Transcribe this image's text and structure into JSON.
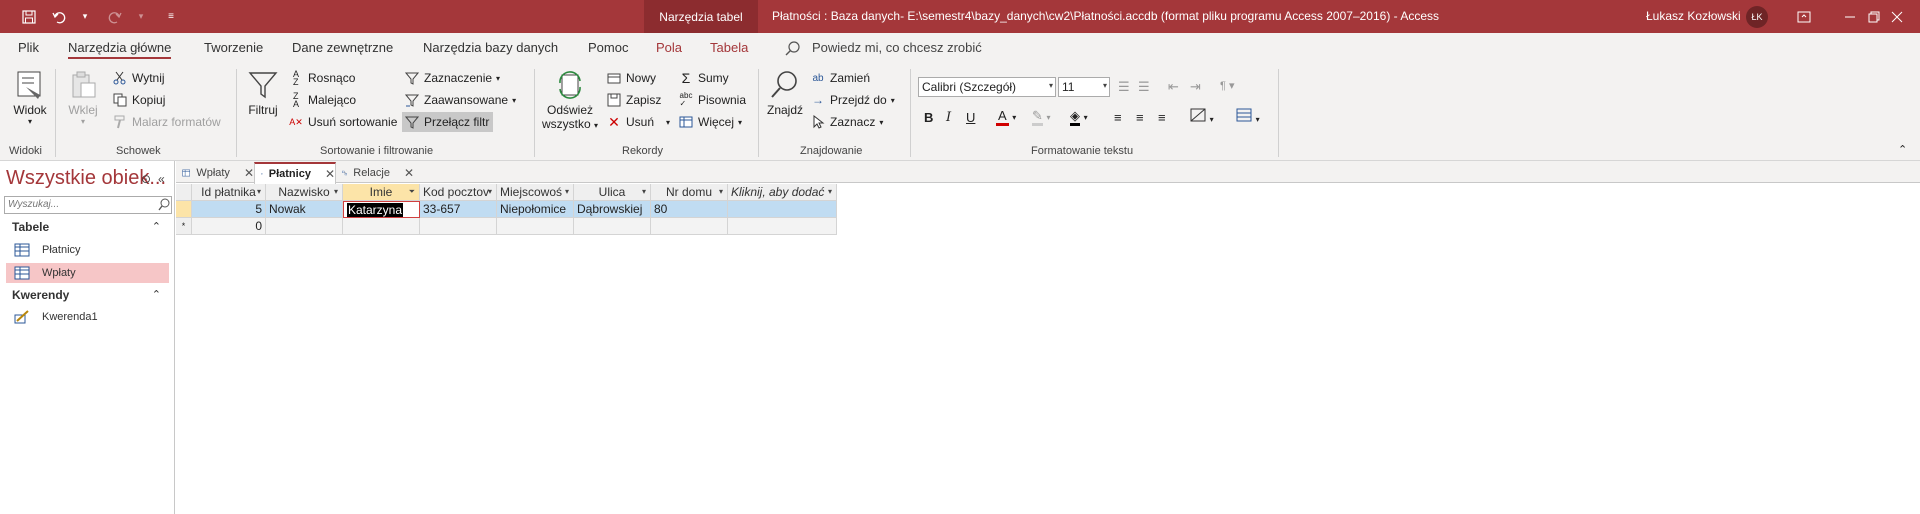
{
  "titlebar": {
    "context_tab": "Narzędzia tabel",
    "title": "Płatności : Baza danych- E:\\semestr4\\bazy_danych\\cw2\\Płatności.accdb (format pliku programu Access 2007–2016)  -  Access",
    "user": "Łukasz Kozłowski",
    "initials": "ŁK",
    "background": "#a4373a"
  },
  "ribbon_tabs": [
    "Plik",
    "Narzędzia główne",
    "Tworzenie",
    "Dane zewnętrzne",
    "Narzędzia bazy danych",
    "Pomoc",
    "Pola",
    "Tabela"
  ],
  "tell_me": "Powiedz mi, co chcesz zrobić",
  "groups": {
    "widoki": {
      "label": "Widoki",
      "widok": "Widok"
    },
    "schowek": {
      "label": "Schowek",
      "wklej": "Wklej",
      "wytnij": "Wytnij",
      "kopiuj": "Kopiuj",
      "malarz": "Malarz formatów"
    },
    "sort": {
      "label": "Sortowanie i filtrowanie",
      "filtruj": "Filtruj",
      "rosnaco": "Rosnąco",
      "malejaco": "Malejąco",
      "usun_sort": "Usuń sortowanie",
      "zaznaczenie": "Zaznaczenie",
      "zaawansowane": "Zaawansowane",
      "przelacz": "Przełącz filtr"
    },
    "rekordy": {
      "label": "Rekordy",
      "odswiez": "Odśwież",
      "wszystko": "wszystko",
      "nowy": "Nowy",
      "zapisz": "Zapisz",
      "usun": "Usuń",
      "sumy": "Sumy",
      "pisownia": "Pisownia",
      "wiecej": "Więcej"
    },
    "znajdowanie": {
      "label": "Znajdowanie",
      "znajdz": "Znajdź",
      "zamien": "Zamień",
      "przejdz": "Przejdź do",
      "zaznacz": "Zaznacz"
    },
    "tekst": {
      "label": "Formatowanie tekstu",
      "font": "Calibri (Szczegół)",
      "size": "11"
    }
  },
  "nav": {
    "title": "Wszystkie obiek...",
    "search_placeholder": "Wyszukaj...",
    "categories": [
      {
        "name": "Tabele",
        "items": [
          "Płatnicy",
          "Wpłaty"
        ]
      },
      {
        "name": "Kwerendy",
        "items": [
          "Kwerenda1"
        ]
      }
    ]
  },
  "doc_tabs": [
    "Wpłaty",
    "Płatnicy",
    "Relacje"
  ],
  "table": {
    "columns": [
      "Id płatnika",
      "Nazwisko",
      "Imie",
      "Kod pocztov",
      "Miejscowoś",
      "Ulica",
      "Nr domu",
      "Kliknij, aby dodać"
    ],
    "rows": [
      [
        "5",
        "Nowak",
        "Katarzyna",
        "33-657",
        "Niepołomice",
        "Dąbrowskiej",
        "80",
        ""
      ],
      [
        "0",
        "",
        "",
        "",
        "",
        "",
        "",
        ""
      ]
    ],
    "new_row_marker": "*"
  },
  "colors": {
    "accent": "#a4373a",
    "selected_nav": "#f6c6c7",
    "current_row": "#c0dcf2"
  }
}
